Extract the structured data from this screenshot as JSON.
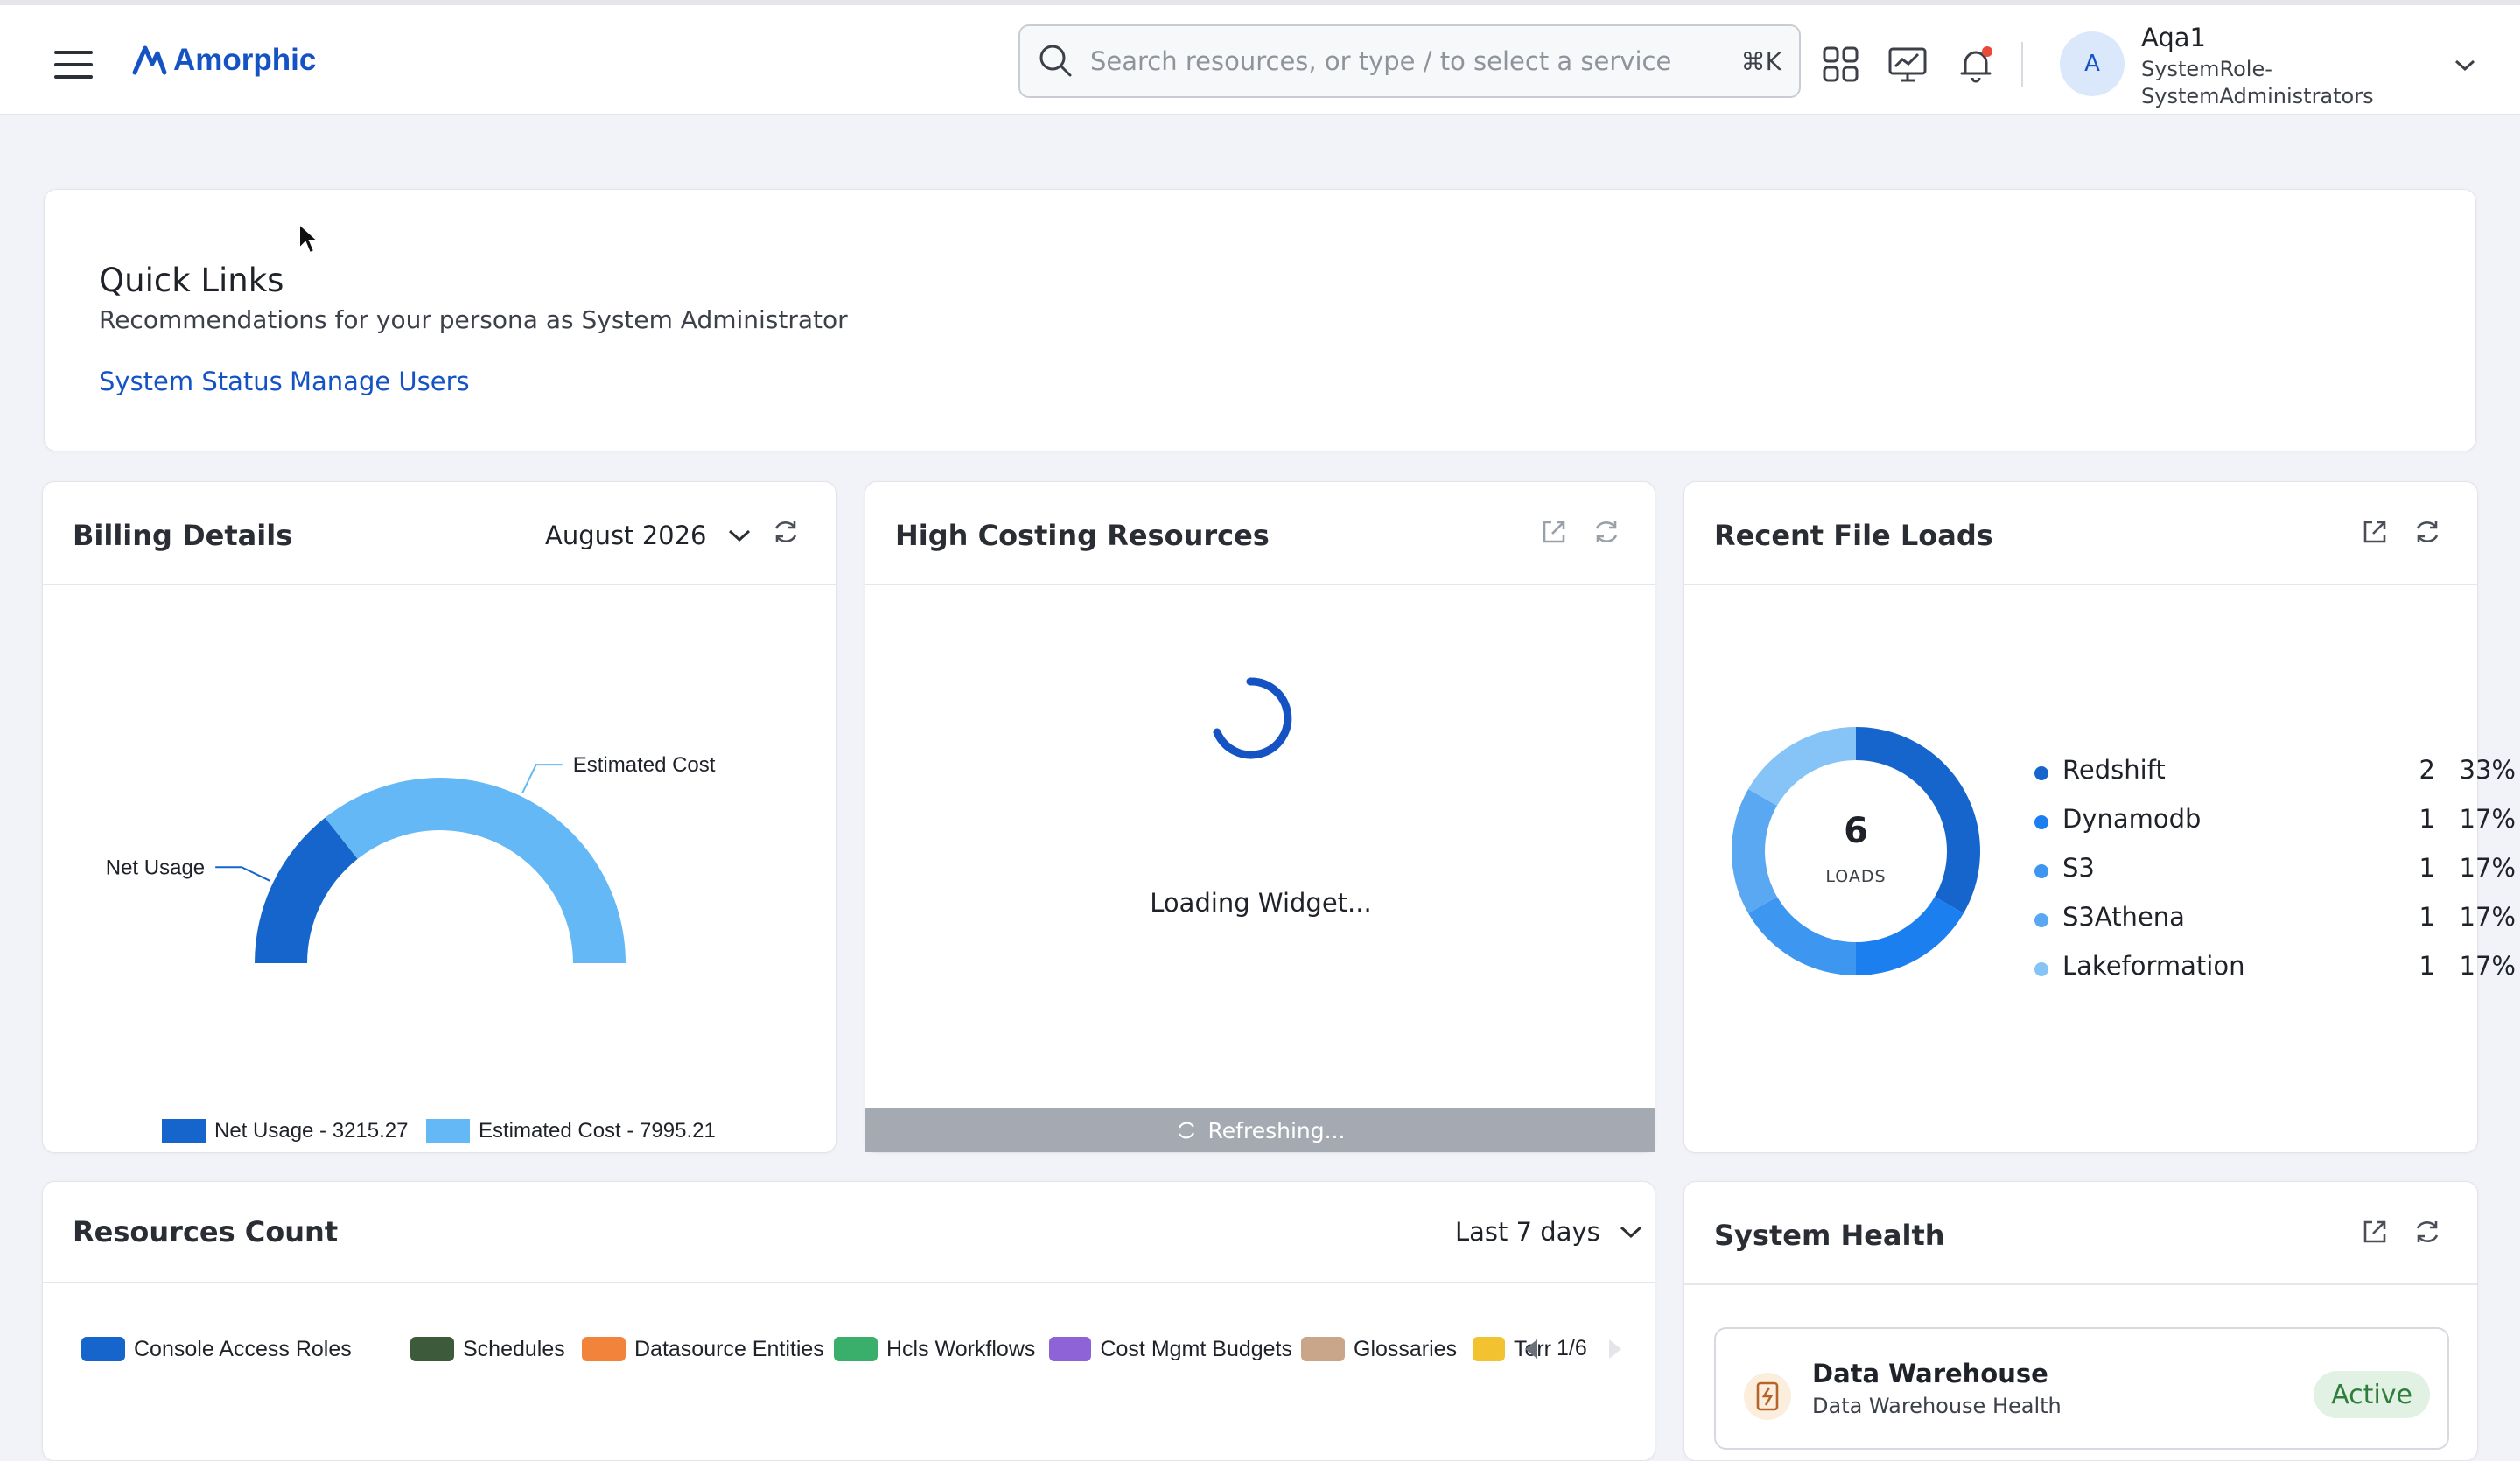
{
  "header": {
    "logo_text": "Amorphic",
    "search": {
      "placeholder": "Search resources, or type / to select a service",
      "shortcut": "⌘K"
    },
    "user": {
      "avatar_initial": "A",
      "name": "Aqa1",
      "role": "SystemRole-SystemAdministrators"
    }
  },
  "quick_links": {
    "title": "Quick Links",
    "subtitle": "Recommendations for your persona as System Administrator",
    "links": [
      "System Status",
      "Manage Users"
    ]
  },
  "billing": {
    "title": "Billing Details",
    "period": "August 2026",
    "chart_data": {
      "type": "pie",
      "labels": [
        "Net Usage",
        "Estimated Cost"
      ],
      "values": [
        3215.27,
        7995.21
      ],
      "legend": [
        "Net Usage - 3215.27",
        "Estimated Cost - 7995.21"
      ],
      "colors": [
        "#1565cc",
        "#63b8f5"
      ]
    }
  },
  "high_costing": {
    "title": "High Costing Resources",
    "loading_text": "Loading Widget...",
    "refresh_text": "Refreshing..."
  },
  "recent_file_loads": {
    "title": "Recent File Loads",
    "total": "6",
    "total_label": "LOADS",
    "chart_data": {
      "type": "pie",
      "items": [
        {
          "name": "Redshift",
          "count": "2",
          "pct": "33%",
          "value": 2,
          "color": "#1565cc"
        },
        {
          "name": "Dynamodb",
          "count": "1",
          "pct": "17%",
          "value": 1,
          "color": "#1b7ff0"
        },
        {
          "name": "S3",
          "count": "1",
          "pct": "17%",
          "value": 1,
          "color": "#3d96f0"
        },
        {
          "name": "S3Athena",
          "count": "1",
          "pct": "17%",
          "value": 1,
          "color": "#5aa8f2"
        },
        {
          "name": "Lakeformation",
          "count": "1",
          "pct": "17%",
          "value": 1,
          "color": "#86c3f7"
        }
      ]
    }
  },
  "resources_count": {
    "title": "Resources Count",
    "range": "Last 7 days",
    "legend": [
      {
        "label": "Console Access Roles",
        "color": "#1565cc"
      },
      {
        "label": "Schedules",
        "color": "#3d5a3a"
      },
      {
        "label": "Datasource Entities",
        "color": "#f2833a"
      },
      {
        "label": "Hcls Workflows",
        "color": "#3aae6b"
      },
      {
        "label": "Cost Mgmt Budgets",
        "color": "#8e63d8"
      },
      {
        "label": "Glossaries",
        "color": "#c9a58a"
      },
      {
        "label": "Terr",
        "color": "#f2c230"
      }
    ],
    "pager": "1/6"
  },
  "system_health": {
    "title": "System Health",
    "item_title": "Data Warehouse",
    "item_sub": "Data Warehouse Health",
    "status": "Active"
  }
}
